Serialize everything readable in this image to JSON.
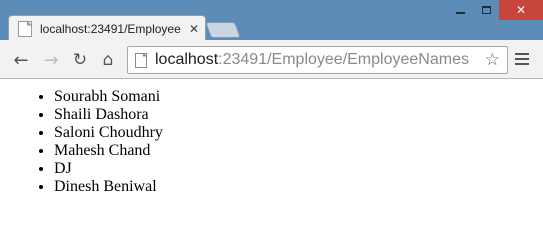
{
  "browser": {
    "tab": {
      "title": "localhost:23491/Employee"
    },
    "address": {
      "host": "localhost",
      "path": ":23491/Employee/EmployeeNames"
    },
    "icons": {
      "back": "back-arrow-icon",
      "forward": "forward-arrow-icon",
      "reload": "reload-icon",
      "home": "home-icon",
      "bookmark": "star-icon",
      "menu": "hamburger-menu-icon"
    },
    "colors": {
      "frame": "#5b8db8",
      "close_button": "#c7463c",
      "toolbar": "#f2f2f2"
    }
  },
  "page": {
    "employees": [
      "Sourabh Somani",
      "Shaili Dashora",
      "Saloni Choudhry",
      "Mahesh Chand",
      "DJ",
      "Dinesh Beniwal"
    ]
  }
}
